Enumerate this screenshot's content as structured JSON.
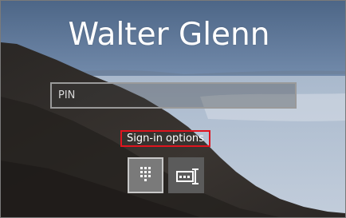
{
  "user": {
    "name": "Walter Glenn"
  },
  "pin_input": {
    "placeholder": "PIN",
    "value": ""
  },
  "sign_in_options": {
    "label": "Sign-in options",
    "highlight_color": "#e0141e"
  },
  "option_buttons": [
    {
      "name": "pin-option",
      "icon": "keypad-icon",
      "selected": true
    },
    {
      "name": "password-option",
      "icon": "password-icon",
      "selected": false
    }
  ]
}
